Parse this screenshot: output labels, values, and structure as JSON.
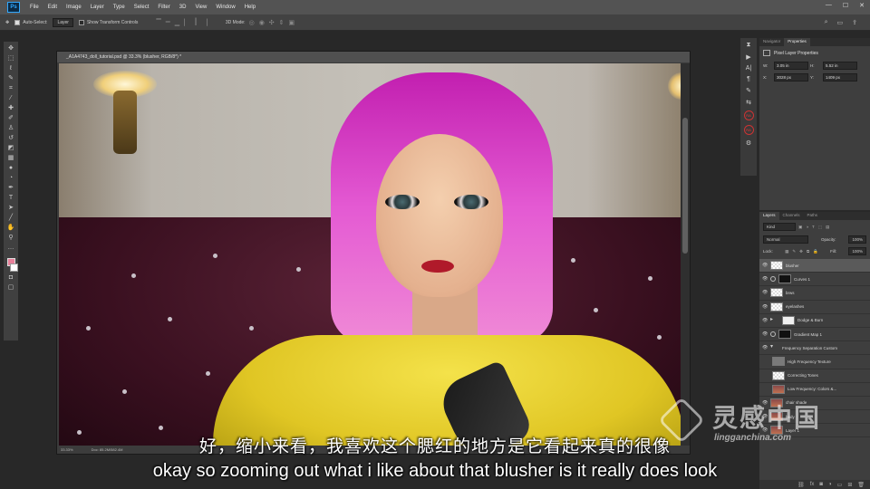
{
  "menubar": {
    "logo": "Ps",
    "items": [
      "File",
      "Edit",
      "Image",
      "Layer",
      "Type",
      "Select",
      "Filter",
      "3D",
      "View",
      "Window",
      "Help"
    ],
    "window_controls": [
      "—",
      "☐",
      "✕"
    ]
  },
  "options": {
    "auto_select_label": "Auto-Select:",
    "auto_select_value": "Layer",
    "transform_label": "Show Transform Controls",
    "mode3d_label": "3D Mode:"
  },
  "document": {
    "tab_title": "_A1A4743_doll_tutorial.psd @ 33.3% (blusher, RGB/8*) *",
    "zoom": "33.33%",
    "doc_size": "Doc: 85.2M/582.4M"
  },
  "properties": {
    "tabs": [
      "Navigator",
      "Properties"
    ],
    "title": "Pixel Layer Properties",
    "w_label": "W:",
    "w_value": "3.05 in",
    "h_label": "H:",
    "h_value": "5.52 in",
    "x_label": "X:",
    "x_value": "3028 px",
    "y_label": "Y:",
    "y_value": "1409 px"
  },
  "layers_panel": {
    "tabs": [
      "Layers",
      "Channels",
      "Paths"
    ],
    "kind_label": "Kind",
    "blend_mode": "Normal",
    "opacity_label": "Opacity:",
    "opacity_value": "100%",
    "lock_label": "Lock:",
    "fill_label": "Fill:",
    "fill_value": "100%",
    "layers": [
      {
        "name": "blusher"
      },
      {
        "name": "Curves 1"
      },
      {
        "name": "brws"
      },
      {
        "name": "eyelashes"
      },
      {
        "name": "Dodge & Burn"
      },
      {
        "name": "Gradient Map 1"
      },
      {
        "name": "Frequency Separation Custom"
      },
      {
        "name": "High Frequency Texture"
      },
      {
        "name": "Correcting Tones"
      },
      {
        "name": "Low Frequency: Colors &..."
      },
      {
        "name": "chair shade"
      },
      {
        "name": "body"
      },
      {
        "name": "Layer 1"
      }
    ]
  },
  "subtitles": {
    "cn": "好，缩小来看，我喜欢这个腮红的地方是它看起来真的很像",
    "en": "okay so zooming out what i like about that blusher is it really does look"
  },
  "watermark": {
    "cn": "灵感中国",
    "url": "lingganchina.com"
  }
}
